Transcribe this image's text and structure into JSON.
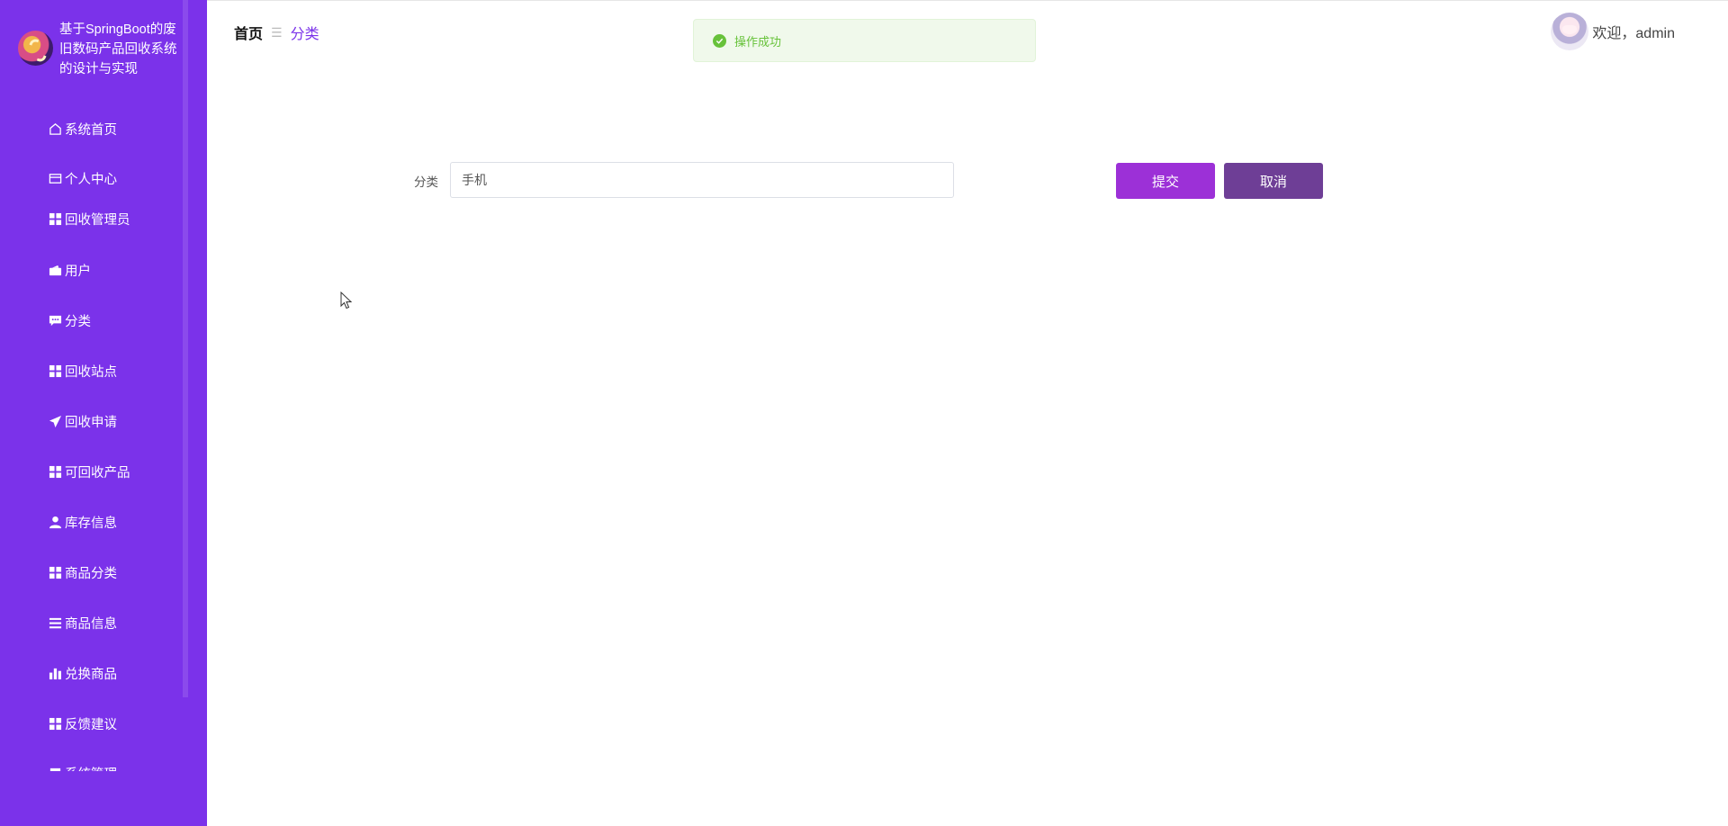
{
  "sidebar": {
    "title": "基于SpringBoot的废旧数码产品回收系统的设计与实现",
    "items": [
      {
        "label": "系统首页",
        "icon": "home-icon"
      },
      {
        "label": "个人中心",
        "icon": "wallet-icon"
      },
      {
        "label": "回收管理员",
        "icon": "grid-icon"
      },
      {
        "label": "用户",
        "icon": "wallet-solid-icon"
      },
      {
        "label": "分类",
        "icon": "chat-icon"
      },
      {
        "label": "回收站点",
        "icon": "grid-icon"
      },
      {
        "label": "回收申请",
        "icon": "send-icon"
      },
      {
        "label": "可回收产品",
        "icon": "grid-icon"
      },
      {
        "label": "库存信息",
        "icon": "user-icon"
      },
      {
        "label": "商品分类",
        "icon": "grid-icon"
      },
      {
        "label": "商品信息",
        "icon": "list-icon"
      },
      {
        "label": "兑换商品",
        "icon": "bar-chart-icon"
      },
      {
        "label": "反馈建议",
        "icon": "grid-icon"
      },
      {
        "label": "系统管理",
        "icon": "square-icon"
      }
    ]
  },
  "breadcrumb": {
    "home": "首页",
    "separator": "☰",
    "current": "分类"
  },
  "toast": {
    "message": "操作成功",
    "color": "#67c23a"
  },
  "header": {
    "welcome": "欢迎，admin"
  },
  "form": {
    "label": "分类",
    "value": "手机",
    "submit_label": "提交",
    "cancel_label": "取消"
  },
  "colors": {
    "sidebar": "#7b32ea",
    "submit": "#9c30d7",
    "cancel": "#6e3e96"
  }
}
